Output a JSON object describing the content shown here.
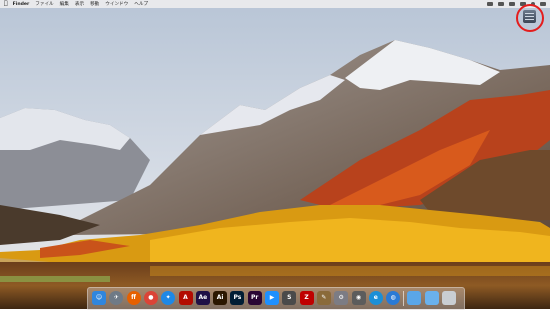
{
  "menubar": {
    "apple_icon": "apple-icon",
    "app_name": "Finder",
    "items": [
      "ファイル",
      "編集",
      "表示",
      "移動",
      "ウインドウ",
      "ヘルプ"
    ]
  },
  "status_icons": [
    "wifi-icon",
    "volume-icon",
    "battery-icon",
    "clock-icon",
    "search-icon",
    "notification-icon"
  ],
  "desktop_icons": [
    {
      "name": "hard-drive-icon",
      "highlight_color": "#e41d1d"
    }
  ],
  "dock": {
    "apps": [
      {
        "id": "finder",
        "icon": "finder-icon",
        "glyph": "☺",
        "color": "#2f86de"
      },
      {
        "id": "launchpad",
        "icon": "launchpad-icon",
        "glyph": "✈",
        "color": "#6f7a86"
      },
      {
        "id": "firefox",
        "icon": "firefox-icon",
        "glyph": "ﬀ",
        "color": "#e66000"
      },
      {
        "id": "chrome",
        "icon": "chrome-icon",
        "glyph": "●",
        "color": "#db4437"
      },
      {
        "id": "safari",
        "icon": "safari-icon",
        "glyph": "✦",
        "color": "#1e88e5"
      },
      {
        "id": "acrobat",
        "icon": "acrobat-icon",
        "glyph": "A",
        "color": "#b30b00"
      },
      {
        "id": "after-effects",
        "icon": "after-effects-icon",
        "glyph": "Ae",
        "color": "#1f1046"
      },
      {
        "id": "illustrator",
        "icon": "illustrator-icon",
        "glyph": "Ai",
        "color": "#2b1700"
      },
      {
        "id": "photoshop",
        "icon": "photoshop-icon",
        "glyph": "Ps",
        "color": "#001d34"
      },
      {
        "id": "premiere",
        "icon": "premiere-icon",
        "glyph": "Pr",
        "color": "#2a0634"
      },
      {
        "id": "app-store",
        "icon": "app-store-icon",
        "glyph": "▶",
        "color": "#1e90ff"
      },
      {
        "id": "sublime",
        "icon": "sublime-text-icon",
        "glyph": "S",
        "color": "#4a4a4a"
      },
      {
        "id": "filezilla",
        "icon": "filezilla-icon",
        "glyph": "Z",
        "color": "#bf0000"
      },
      {
        "id": "script-editor",
        "icon": "script-editor-icon",
        "glyph": "✎",
        "color": "#8a6a3a"
      },
      {
        "id": "system-prefs",
        "icon": "system-preferences-icon",
        "glyph": "⚙",
        "color": "#7c7c84"
      },
      {
        "id": "disk-utility",
        "icon": "disk-utility-icon",
        "glyph": "◉",
        "color": "#5c5c5c"
      },
      {
        "id": "edge",
        "icon": "edge-icon",
        "glyph": "e",
        "color": "#1b8fd6"
      },
      {
        "id": "network",
        "icon": "globe-icon",
        "glyph": "◍",
        "color": "#2a7ad5"
      },
      {
        "id": "downloads",
        "icon": "folder-icon",
        "glyph": "",
        "color": "#5aa6e8"
      },
      {
        "id": "folder2",
        "icon": "folder-icon",
        "glyph": "",
        "color": "#6ab1ec"
      },
      {
        "id": "trash",
        "icon": "trash-icon",
        "glyph": "",
        "color": "#c9ced3"
      }
    ]
  }
}
